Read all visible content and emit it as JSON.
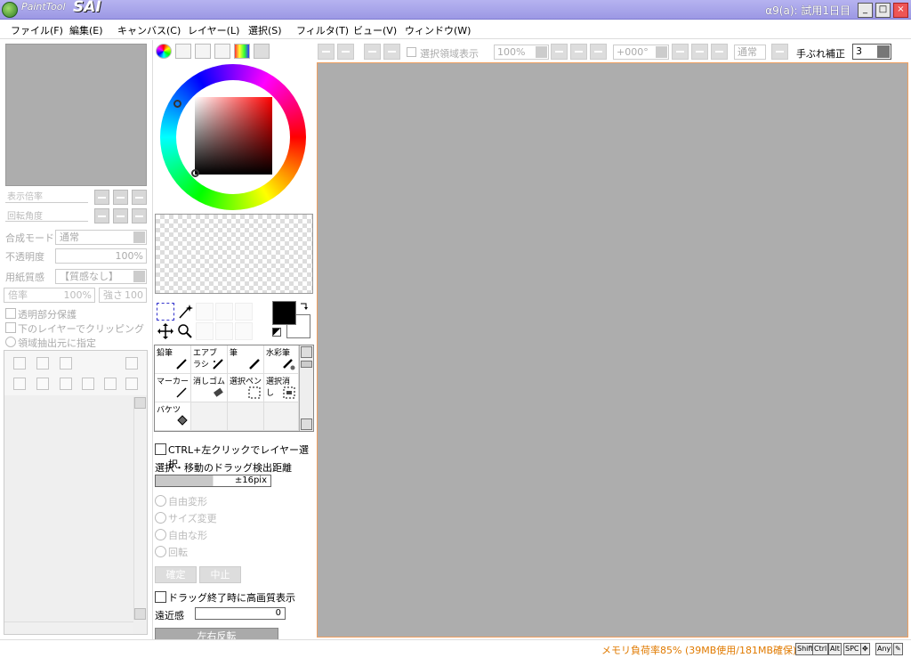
{
  "titlebar": {
    "app_name": "PaintTool",
    "app_brand": "SAI",
    "right_text": "α9(a): 試用1日目",
    "min": "_",
    "max": "□",
    "close": "×"
  },
  "menu": [
    "ファイル(F)",
    "編集(E)",
    "キャンバス(C)",
    "レイヤー(L)",
    "選択(S)",
    "フィルタ(T)",
    "ビュー(V)",
    "ウィンドウ(W)"
  ],
  "navigator": {
    "zoom_label": "表示倍率",
    "rotate_label": "回転角度"
  },
  "layer_props": {
    "blend_label": "合成モード",
    "blend_value": "通常",
    "opacity_label": "不透明度",
    "opacity_value": "100%",
    "texture_label": "用紙質感",
    "texture_value": "【質感なし】",
    "scale_label": "倍率",
    "scale_value": "100%",
    "strength_label": "強さ",
    "strength_value": "100",
    "protect_alpha": "透明部分保護",
    "clip_lower": "下のレイヤーでクリッピング",
    "selection_source": "領域抽出元に指定"
  },
  "brushes": [
    {
      "label": "鉛筆"
    },
    {
      "label": "エアブラシ"
    },
    {
      "label": "筆"
    },
    {
      "label": "水彩筆"
    },
    {
      "label": "マーカー"
    },
    {
      "label": "消しゴム"
    },
    {
      "label": "選択ペン"
    },
    {
      "label": "選択消し"
    },
    {
      "label": "バケツ"
    }
  ],
  "tool_options": {
    "ctrl_click": "CTRL+左クリックでレイヤー選択",
    "drag_distance_label": "選択・移動のドラッグ検出距離",
    "drag_distance_value": "±16pix",
    "drag_fraction": 0.5,
    "free_transform": "自由変形",
    "resize": "サイズ変更",
    "free_shape": "自由な形",
    "rotate": "回転",
    "confirm": "確定",
    "cancel": "中止",
    "hq_preview": "ドラッグ終了時に高画質表示",
    "perspective_label": "遠近感",
    "perspective_value": "0",
    "flip_button": "左右反転"
  },
  "toolbar": {
    "show_selection": "選択領域表示",
    "zoom_value": "100%",
    "angle_value": "+000°",
    "blend_value": "通常",
    "stabilizer_label": "手ぶれ補正",
    "stabilizer_value": "3"
  },
  "status": {
    "memory": "メモリ負荷率85% (39MB使用/181MB確保)",
    "keys": [
      "Shift",
      "Ctrl",
      "Alt",
      "SPC",
      "✥",
      "Any",
      "✎"
    ]
  },
  "colors": {
    "foreground": "#000000",
    "background": "#ffffff",
    "canvas": "#adadad",
    "status_text": "#e07a00"
  }
}
